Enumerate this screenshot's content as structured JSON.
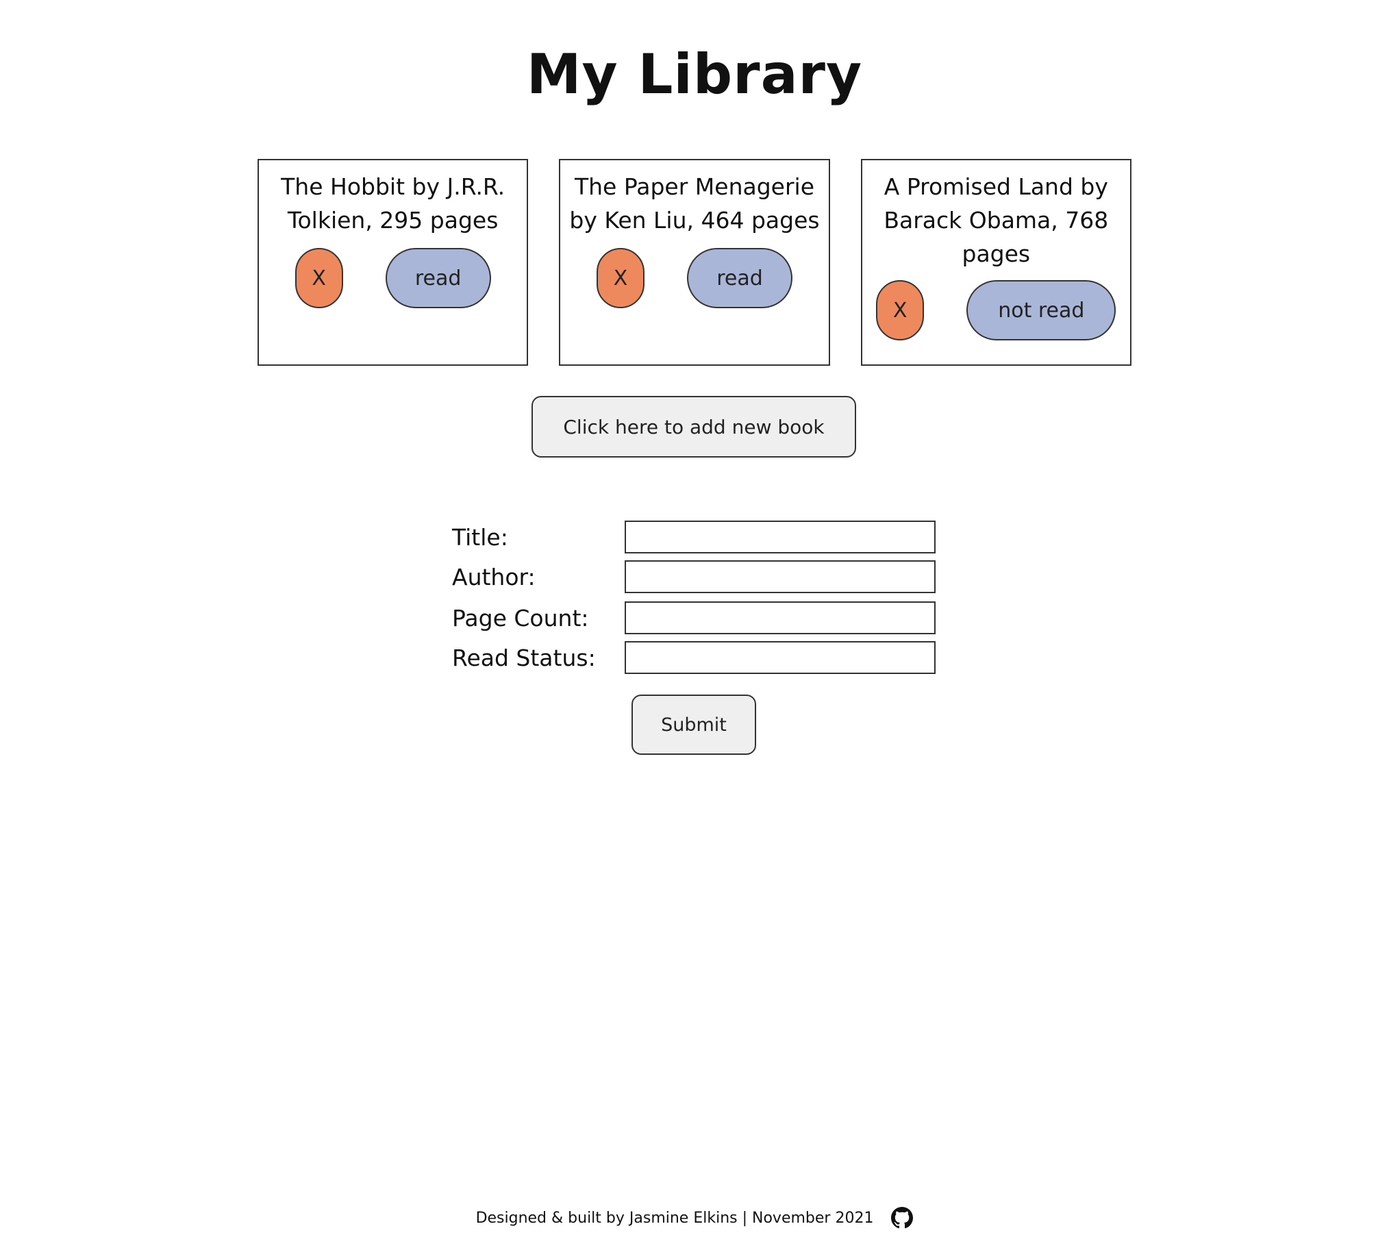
{
  "header": {
    "title": "My Library"
  },
  "books": [
    {
      "text": "The Hobbit by J.R.R. Tolkien, 295 pages",
      "delete_label": "X",
      "status_label": "read"
    },
    {
      "text": "The Paper Menagerie by Ken Liu, 464 pages",
      "delete_label": "X",
      "status_label": "read"
    },
    {
      "text": "A Promised Land by Barack Obama, 768 pages",
      "delete_label": "X",
      "status_label": "not read"
    }
  ],
  "add_button": {
    "label": "Click here to add new book"
  },
  "form": {
    "title_label": "Title:",
    "author_label": "Author:",
    "page_count_label": "Page Count:",
    "read_status_label": "Read Status:",
    "submit_label": "Submit"
  },
  "footer": {
    "text": "Designed & built by Jasmine Elkins | November 2021",
    "icon": "github-icon"
  },
  "colors": {
    "delete_button": "#ee885d",
    "status_button": "#aab6d8",
    "neutral_button": "#efefef",
    "border": "#333333"
  }
}
